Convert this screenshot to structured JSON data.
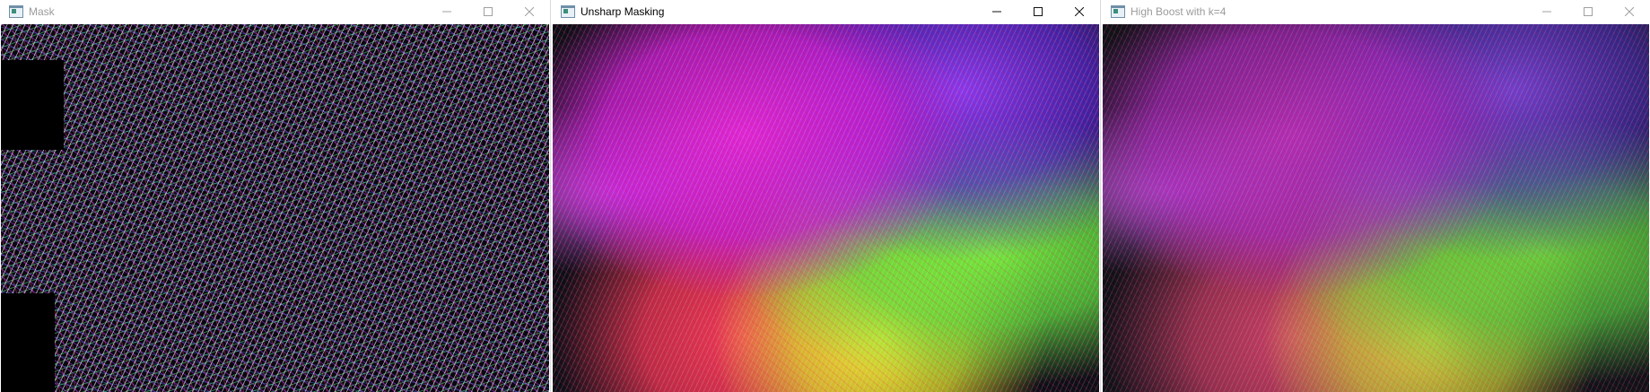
{
  "windows": [
    {
      "title": "Mask",
      "state": "inactive",
      "content": "mask-image"
    },
    {
      "title": "Unsharp Masking",
      "state": "active",
      "content": "unsharp-masked-image"
    },
    {
      "title": "High Boost with k=4",
      "state": "inactive",
      "content": "high-boost-image"
    }
  ],
  "icons": {
    "app": "opencv-window-icon",
    "minimize": "minimize-icon",
    "maximize": "maximize-icon",
    "close": "close-icon"
  },
  "colors": {
    "titlebar_bg": "#ffffff",
    "title_active": "#000000",
    "title_inactive": "#9b9b9b"
  }
}
